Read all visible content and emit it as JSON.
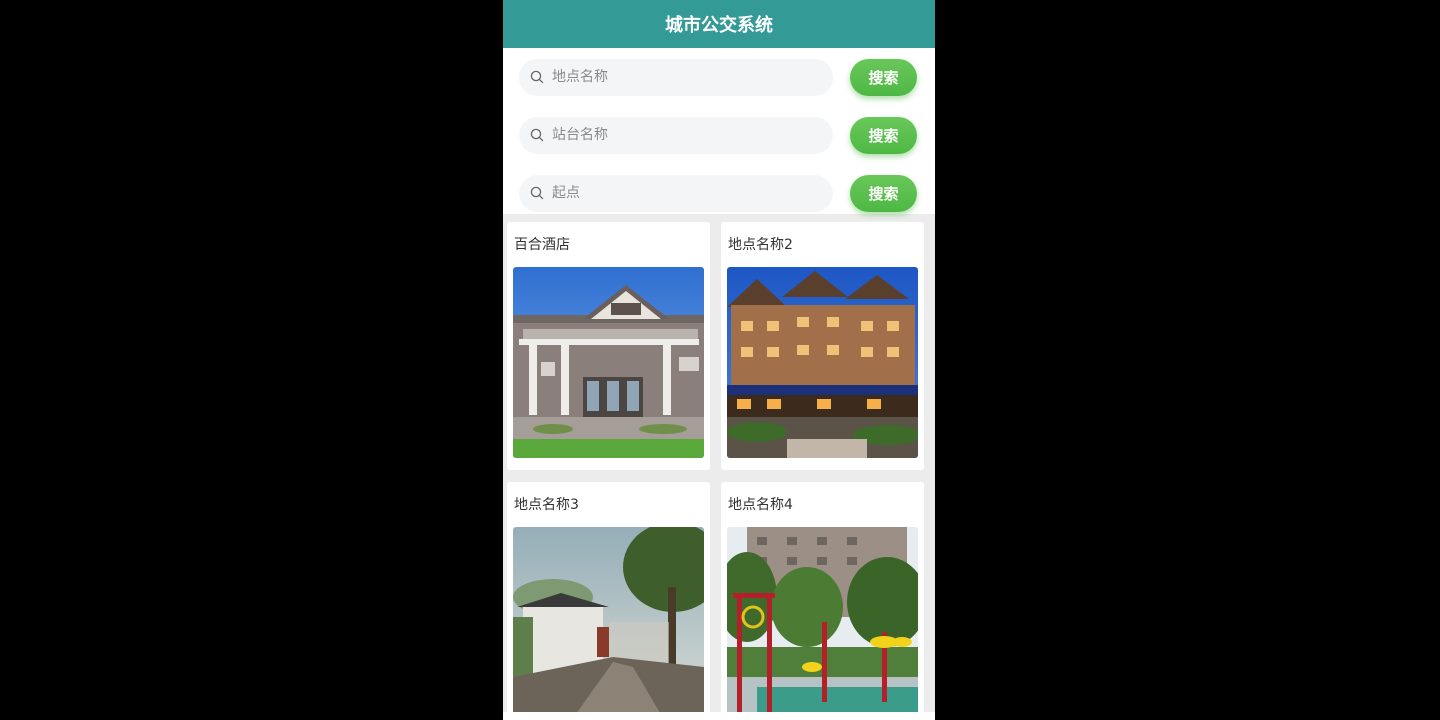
{
  "header": {
    "title": "城市公交系统"
  },
  "searches": [
    {
      "placeholder": "地点名称",
      "button": "搜索"
    },
    {
      "placeholder": "站台名称",
      "button": "搜索"
    },
    {
      "placeholder": "起点",
      "button": "搜索"
    }
  ],
  "places": [
    {
      "title": "百合酒店"
    },
    {
      "title": "地点名称2"
    },
    {
      "title": "地点名称3"
    },
    {
      "title": "地点名称4"
    }
  ],
  "colors": {
    "header_bg": "#349a96",
    "search_button": "#56bd4a",
    "page_bg": "#ececec"
  }
}
